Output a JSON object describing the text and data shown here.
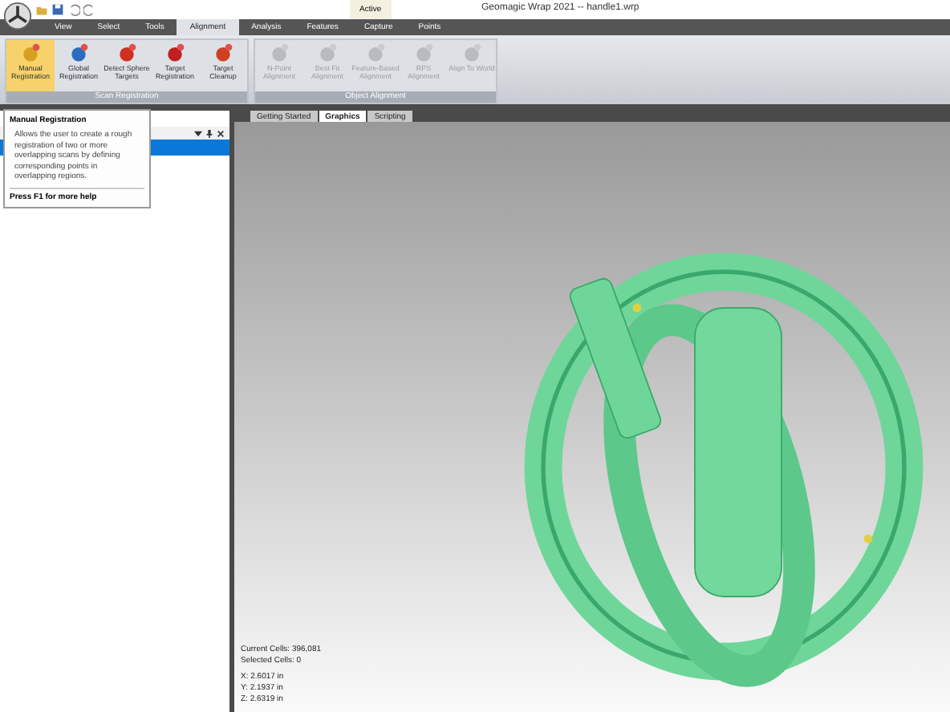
{
  "window": {
    "title": "Geomagic Wrap 2021 -- handle1.wrp",
    "context_badge": "Active"
  },
  "menu_tabs": [
    {
      "label": "View",
      "selected": false
    },
    {
      "label": "Select",
      "selected": false
    },
    {
      "label": "Tools",
      "selected": false
    },
    {
      "label": "Alignment",
      "selected": true
    },
    {
      "label": "Analysis",
      "selected": false
    },
    {
      "label": "Features",
      "selected": false
    },
    {
      "label": "Capture",
      "selected": false
    },
    {
      "label": "Points",
      "selected": false
    }
  ],
  "ribbon_groups": [
    {
      "title": "Scan Registration",
      "buttons": [
        {
          "label": "Manual Registration",
          "selected": true,
          "disabled": false
        },
        {
          "label": "Global Registration",
          "selected": false,
          "disabled": false
        },
        {
          "label": "Detect Sphere Targets",
          "selected": false,
          "disabled": false
        },
        {
          "label": "Target Registration",
          "selected": false,
          "disabled": false
        },
        {
          "label": "Target Cleanup",
          "selected": false,
          "disabled": false
        }
      ]
    },
    {
      "title": "Object Alignment",
      "buttons": [
        {
          "label": "N-Point Alignment",
          "selected": false,
          "disabled": true
        },
        {
          "label": "Best Fit Alignment",
          "selected": false,
          "disabled": true
        },
        {
          "label": "Feature-Based Alignment",
          "selected": false,
          "disabled": true
        },
        {
          "label": "RPS Alignment",
          "selected": false,
          "disabled": true
        },
        {
          "label": "Align To World",
          "selected": false,
          "disabled": true
        }
      ]
    }
  ],
  "tooltip": {
    "title": "Manual Registration",
    "body": "Allows the user to create a rough registration of two or more overlapping scans by defining corresponding points in overlapping regions.",
    "footer": "Press F1 for more help"
  },
  "view_tabs": [
    {
      "label": "Getting Started",
      "selected": false
    },
    {
      "label": "Graphics",
      "selected": true
    },
    {
      "label": "Scripting",
      "selected": false
    }
  ],
  "status": {
    "cells": [
      "Current Cells: 396,081",
      "Selected Cells: 0"
    ],
    "coords": [
      "X:  2.6017 in",
      "Y:  2.1937 in",
      "Z:  2.6319 in"
    ]
  }
}
